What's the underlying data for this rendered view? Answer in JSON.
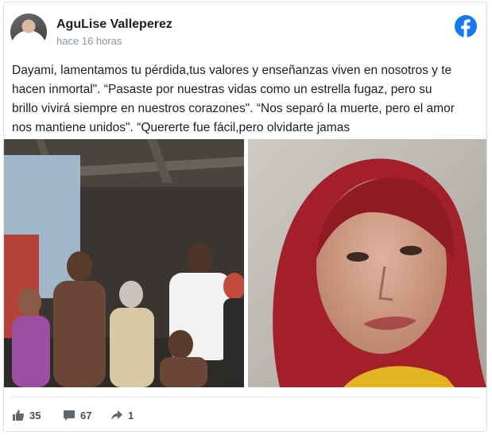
{
  "post": {
    "author": "AguLise Valleperez",
    "timestamp": "hace 16 horas",
    "platform_icon": "facebook-icon",
    "message": "Dayami, lamentamos tu pérdida,tus valores y enseñanzas viven en nosotros y te hacen inmortal\". “Pasaste por nuestras vidas como un estrella fugaz, pero su brillo vivirá siempre en nuestros corazones\". “Nos separó la muerte, pero el amor nos mantiene unidos\". “Quererte fue fácil,pero olvidarte jamas"
  },
  "stats": {
    "likes": "35",
    "comments": "67",
    "shares": "1"
  },
  "colors": {
    "facebook_blue": "#1877f2",
    "text": "#1c1e21",
    "muted": "#8d949e",
    "action_gray": "#4b4f56"
  },
  "icons": [
    "facebook-icon",
    "like-icon",
    "comment-icon",
    "share-icon"
  ]
}
